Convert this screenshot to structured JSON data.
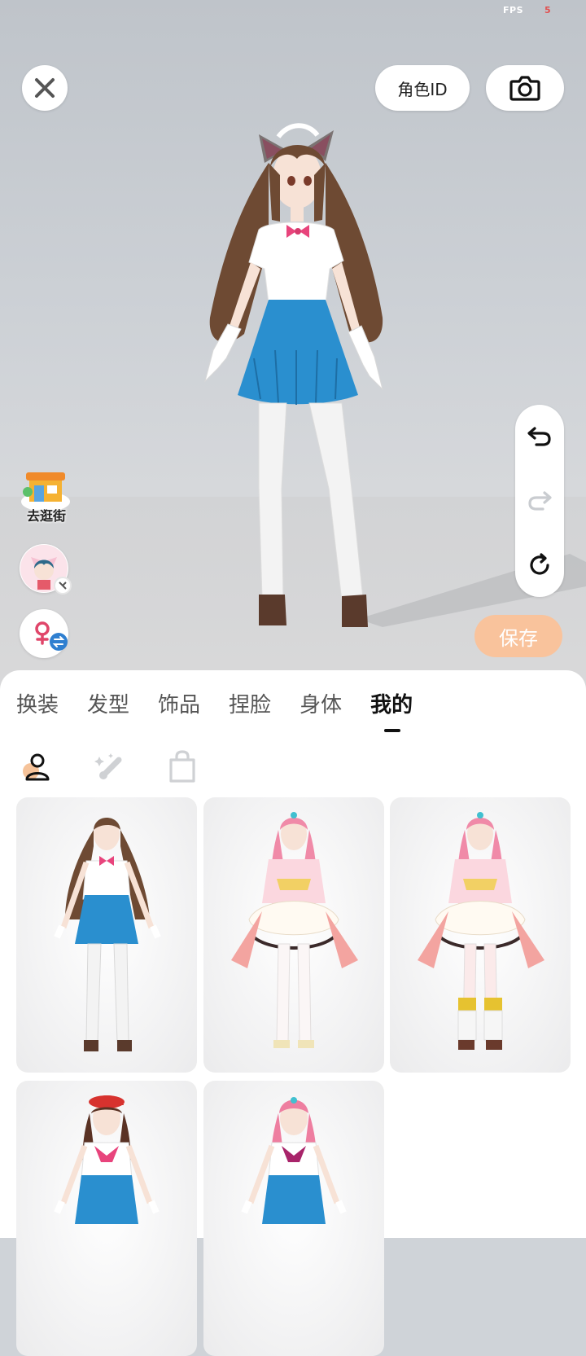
{
  "status": {
    "fps_label": "FPS",
    "fps_value": "5"
  },
  "header": {
    "close_icon": "close-icon",
    "role_id_label": "角色ID",
    "camera_icon": "camera-icon"
  },
  "history": {
    "undo_icon": "undo-icon",
    "redo_icon": "redo-icon",
    "reset_icon": "reset-icon"
  },
  "side": {
    "shop_label": "去逛街",
    "avatar_switch_icon": "avatar-switch-icon",
    "gender_switch_icon": "gender-switch-icon"
  },
  "save_label": "保存",
  "tabs": [
    {
      "label": "换装"
    },
    {
      "label": "发型"
    },
    {
      "label": "饰品"
    },
    {
      "label": "捏脸"
    },
    {
      "label": "身体"
    },
    {
      "label": "我的",
      "active": true
    }
  ],
  "subtabs": [
    {
      "icon": "person-icon",
      "active": true
    },
    {
      "icon": "magic-brush-icon",
      "active": false
    },
    {
      "icon": "shopping-bag-icon",
      "active": false
    }
  ],
  "outfits": [
    {
      "name": "brown-hair-blue-skirt-outfit"
    },
    {
      "name": "pink-hair-frilly-dress-outfit"
    },
    {
      "name": "pink-hair-frilly-dress-boots-outfit"
    },
    {
      "name": "red-beret-sailor-outfit"
    },
    {
      "name": "pink-hair-sailor-outfit"
    }
  ],
  "colors": {
    "save_button": "#f9c39c",
    "accent_blue": "#2f7fd0",
    "skirt_blue": "#2a8fcf",
    "gender_pink": "#e0466a"
  }
}
